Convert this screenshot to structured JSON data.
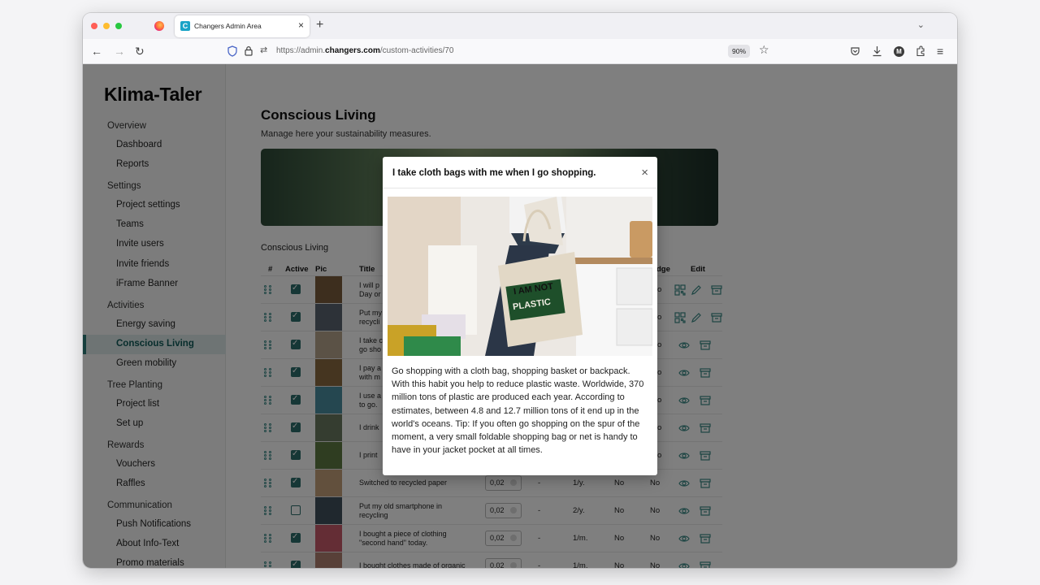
{
  "browser": {
    "tab_title": "Changers Admin Area",
    "url_prefix": "https://admin.",
    "url_domain": "changers.com",
    "url_path": "/custom-activities/70",
    "zoom": "90%"
  },
  "sidebar": {
    "logo": "Klima-Taler",
    "sections": [
      {
        "label": "Overview",
        "items": [
          "Dashboard",
          "Reports"
        ]
      },
      {
        "label": "Settings",
        "items": [
          "Project settings",
          "Teams",
          "Invite users",
          "Invite friends",
          "iFrame Banner"
        ]
      },
      {
        "label": "Activities",
        "items": [
          "Energy saving",
          "Conscious Living",
          "Green mobility"
        ]
      },
      {
        "label": "Tree Planting",
        "items": [
          "Project list",
          "Set up"
        ]
      },
      {
        "label": "Rewards",
        "items": [
          "Vouchers",
          "Raffles"
        ]
      },
      {
        "label": "Communication",
        "items": [
          "Push Notifications",
          "About Info-Text",
          "Promo materials"
        ]
      }
    ],
    "active_item": "Conscious Living"
  },
  "main": {
    "title": "Conscious Living",
    "subtitle": "Manage here your sustainability measures.",
    "section_title": "Conscious Living",
    "columns": {
      "num": "#",
      "active": "Active",
      "pic": "Pic",
      "title": "Title",
      "badge": "dge",
      "edit": "Edit"
    },
    "rows": [
      {
        "active": true,
        "title": "I will p\nDay or",
        "value": "",
        "dash": "",
        "freq": "",
        "a": "",
        "b": "o",
        "edit_type": "full"
      },
      {
        "active": true,
        "title": "Put my\nrecycli",
        "value": "",
        "dash": "",
        "freq": "",
        "a": "",
        "b": "o",
        "edit_type": "full"
      },
      {
        "active": true,
        "title": "I take c\ngo sho",
        "value": "",
        "dash": "",
        "freq": "",
        "a": "",
        "b": "o",
        "edit_type": "view"
      },
      {
        "active": true,
        "title": "I pay a\nwith m",
        "value": "",
        "dash": "",
        "freq": "",
        "a": "",
        "b": "o",
        "edit_type": "view"
      },
      {
        "active": true,
        "title": "I use a\nto go.",
        "value": "",
        "dash": "",
        "freq": "",
        "a": "",
        "b": "o",
        "edit_type": "view"
      },
      {
        "active": true,
        "title": "I drink",
        "value": "",
        "dash": "",
        "freq": "",
        "a": "",
        "b": "o",
        "edit_type": "view"
      },
      {
        "active": true,
        "title": "I print",
        "value": "",
        "dash": "",
        "freq": "",
        "a": "",
        "b": "o",
        "edit_type": "view"
      },
      {
        "active": true,
        "title": "Switched to recycled paper",
        "value": "0,02",
        "dash": "-",
        "freq": "1/y.",
        "a": "No",
        "b": "No",
        "edit_type": "view"
      },
      {
        "active": false,
        "title": "Put my old smartphone in\nrecycling",
        "value": "0,02",
        "dash": "-",
        "freq": "2/y.",
        "a": "No",
        "b": "No",
        "edit_type": "view"
      },
      {
        "active": true,
        "title": "I bought a piece of clothing\n\"second hand\" today.",
        "value": "0,02",
        "dash": "-",
        "freq": "1/m.",
        "a": "No",
        "b": "No",
        "edit_type": "view"
      },
      {
        "active": true,
        "title": "I bought clothes made of organic",
        "value": "0,02",
        "dash": "-",
        "freq": "1/m.",
        "a": "No",
        "b": "No",
        "edit_type": "view"
      }
    ]
  },
  "modal": {
    "title": "I take cloth bags with me when I go shopping.",
    "close": "×",
    "bag_text_1": "I AM NOT",
    "bag_text_2": "PLASTIC",
    "body": "Go shopping with a cloth bag, shopping basket or backpack. With this habit you help to reduce plastic waste. Worldwide, 370 million tons of plastic are produced each year. According to estimates, between 4.8 and 12.7 million tons of it end up in the world's oceans. Tip: If you often go shopping on the spur of the moment, a very small foldable shopping bag or net is handy to have in your jacket pocket at all times."
  },
  "colors": {
    "accent": "#2d6e6c",
    "active_bg": "#dce9e8"
  }
}
